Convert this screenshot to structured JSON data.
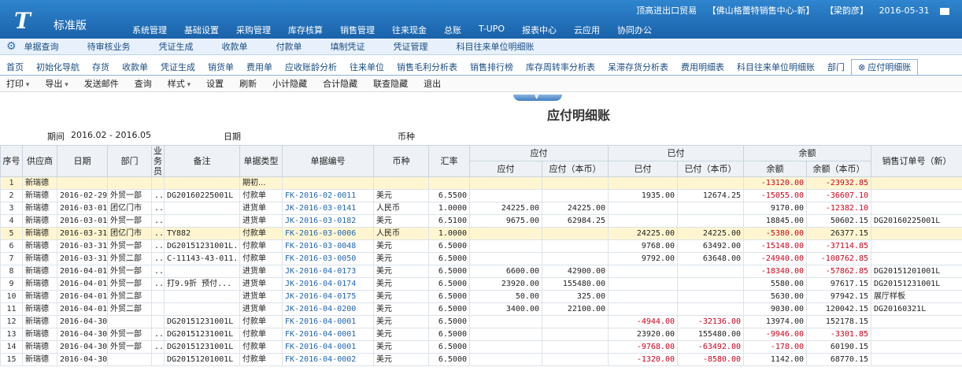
{
  "app": {
    "logo": "T",
    "logo_name": "标准版",
    "nav": [
      "系统管理",
      "基础设置",
      "采购管理",
      "库存核算",
      "销售管理",
      "往来现金",
      "总账",
      "T-UPO",
      "报表中心",
      "云应用",
      "协同办公"
    ],
    "company": "顶高进出口贸易",
    "org": "【佛山格蕾特销售中心-新】",
    "user": "【梁韵彦】",
    "date": "2016-05-31"
  },
  "subnav": [
    "单据查询",
    "待审核业务",
    "凭证生成",
    "收款单",
    "付款单",
    "填制凭证",
    "凭证管理",
    "科目往来单位明细账"
  ],
  "tabs": [
    "首页",
    "初始化导航",
    "存货",
    "收款单",
    "凭证生成",
    "销货单",
    "费用单",
    "应收账龄分析",
    "往来单位",
    "销售毛利分析表",
    "销售排行榜",
    "库存周转率分析表",
    "呆滞存货分析表",
    "费用明细表",
    "科目往来单位明细账",
    "部门",
    "应付明细账"
  ],
  "toolbar": [
    "打印",
    "导出",
    "发送邮件",
    "查询",
    "样式",
    "设置",
    "刷新",
    "小计隐藏",
    "合计隐藏",
    "联查隐藏",
    "退出"
  ],
  "report": {
    "title": "应付明细账",
    "period_label": "期间",
    "period_value": "2016.02 - 2016.05",
    "date_label": "日期",
    "currency_label": "币种"
  },
  "headers": {
    "idx": "序号",
    "supplier": "供应商",
    "date": "日期",
    "dept": "部门",
    "clerk": "业务员",
    "note": "备注",
    "btype": "单据类型",
    "bno": "单据编号",
    "cur": "币种",
    "rate": "汇率",
    "payable": "应付",
    "payable_amt": "应付",
    "payable_base": "应付（本币）",
    "paid": "已付",
    "paid_amt": "已付",
    "paid_base": "已付（本币）",
    "balance": "余额",
    "bal_amt": "余额",
    "bal_base": "余额（本币）",
    "order": "销售订单号（新）"
  },
  "rows": [
    {
      "idx": "1",
      "supplier": "新瑞德",
      "date": "",
      "dept": "",
      "clerk": "",
      "note": "",
      "btype": "期初...",
      "bno": "",
      "cur": "",
      "rate": "",
      "pay": "",
      "payb": "",
      "paid": "",
      "paidb": "",
      "bal": "-13120.00",
      "balb": "-23932.85",
      "order": "",
      "hl": true
    },
    {
      "idx": "2",
      "supplier": "新瑞德",
      "date": "2016-02-29",
      "dept": "外贸一部",
      "clerk": "...",
      "note": "DG20160225001L",
      "btype": "付款单",
      "bno": "FK-2016-02-0011",
      "cur": "美元",
      "rate": "6.5500",
      "pay": "",
      "payb": "",
      "paid": "1935.00",
      "paidb": "12674.25",
      "bal": "-15055.00",
      "balb": "-36607.10",
      "order": ""
    },
    {
      "idx": "3",
      "supplier": "新瑞德",
      "date": "2016-03-01",
      "dept": "团亿门市",
      "clerk": "...",
      "note": "",
      "btype": "进货单",
      "bno": "JK-2016-03-0141",
      "cur": "人民币",
      "rate": "1.0000",
      "pay": "24225.00",
      "payb": "24225.00",
      "paid": "",
      "paidb": "",
      "bal": "9170.00",
      "balb": "-12382.10",
      "order": ""
    },
    {
      "idx": "4",
      "supplier": "新瑞德",
      "date": "2016-03-01",
      "dept": "外贸一部",
      "clerk": "...",
      "note": "",
      "btype": "进货单",
      "bno": "JK-2016-03-0182",
      "cur": "美元",
      "rate": "6.5100",
      "pay": "9675.00",
      "payb": "62984.25",
      "paid": "",
      "paidb": "",
      "bal": "18845.00",
      "balb": "50602.15",
      "order": "DG20160225001L"
    },
    {
      "idx": "5",
      "supplier": "新瑞德",
      "date": "2016-03-31",
      "dept": "团亿门市",
      "clerk": "...",
      "note": "TY882",
      "btype": "付款单",
      "bno": "FK-2016-03-0006",
      "cur": "人民币",
      "rate": "1.0000",
      "pay": "",
      "payb": "",
      "paid": "24225.00",
      "paidb": "24225.00",
      "bal": "-5380.00",
      "balb": "26377.15",
      "order": "",
      "hl": true
    },
    {
      "idx": "6",
      "supplier": "新瑞德",
      "date": "2016-03-31",
      "dept": "外贸一部",
      "clerk": "...",
      "note": "DG20151231001L...",
      "btype": "付款单",
      "bno": "FK-2016-03-0048",
      "cur": "美元",
      "rate": "6.5000",
      "pay": "",
      "payb": "",
      "paid": "9768.00",
      "paidb": "63492.00",
      "bal": "-15148.00",
      "balb": "-37114.85",
      "order": ""
    },
    {
      "idx": "7",
      "supplier": "新瑞德",
      "date": "2016-03-31",
      "dept": "外贸二部",
      "clerk": "...",
      "note": "C-11143-43-011...",
      "btype": "付款单",
      "bno": "FK-2016-03-0050",
      "cur": "美元",
      "rate": "6.5000",
      "pay": "",
      "payb": "",
      "paid": "9792.00",
      "paidb": "63648.00",
      "bal": "-24940.00",
      "balb": "-100762.85",
      "order": ""
    },
    {
      "idx": "8",
      "supplier": "新瑞德",
      "date": "2016-04-01",
      "dept": "外贸一部",
      "clerk": "...",
      "note": "",
      "btype": "进货单",
      "bno": "JK-2016-04-0173",
      "cur": "美元",
      "rate": "6.5000",
      "pay": "6600.00",
      "payb": "42900.00",
      "paid": "",
      "paidb": "",
      "bal": "-18340.00",
      "balb": "-57862.85",
      "order": "DG20151201001L"
    },
    {
      "idx": "9",
      "supplier": "新瑞德",
      "date": "2016-04-01",
      "dept": "外贸一部",
      "clerk": "...",
      "note": "打9.9折  预付...",
      "btype": "进货单",
      "bno": "JK-2016-04-0174",
      "cur": "美元",
      "rate": "6.5000",
      "pay": "23920.00",
      "payb": "155480.00",
      "paid": "",
      "paidb": "",
      "bal": "5580.00",
      "balb": "97617.15",
      "order": "DG20151231001L"
    },
    {
      "idx": "10",
      "supplier": "新瑞德",
      "date": "2016-04-01",
      "dept": "外贸二部",
      "clerk": "",
      "note": "",
      "btype": "进货单",
      "bno": "JK-2016-04-0175",
      "cur": "美元",
      "rate": "6.5000",
      "pay": "50.00",
      "payb": "325.00",
      "paid": "",
      "paidb": "",
      "bal": "5630.00",
      "balb": "97942.15",
      "order": "展厅样板"
    },
    {
      "idx": "11",
      "supplier": "新瑞德",
      "date": "2016-04-01",
      "dept": "外贸二部",
      "clerk": "",
      "note": "",
      "btype": "进货单",
      "bno": "JK-2016-04-0200",
      "cur": "美元",
      "rate": "6.5000",
      "pay": "3400.00",
      "payb": "22100.00",
      "paid": "",
      "paidb": "",
      "bal": "9030.00",
      "balb": "120042.15",
      "order": "DG20160321L"
    },
    {
      "idx": "12",
      "supplier": "新瑞德",
      "date": "2016-04-30",
      "dept": "",
      "clerk": "",
      "note": "DG20151231001L",
      "btype": "付款单",
      "bno": "FK-2016-04-0001",
      "cur": "美元",
      "rate": "6.5000",
      "pay": "",
      "payb": "",
      "paid": "-4944.00",
      "paidb": "-32136.00",
      "bal": "13974.00",
      "balb": "152178.15",
      "order": ""
    },
    {
      "idx": "13",
      "supplier": "新瑞德",
      "date": "2016-04-30",
      "dept": "外贸一部",
      "clerk": "...",
      "note": "DG20151231001L",
      "btype": "付款单",
      "bno": "FK-2016-04-0001",
      "cur": "美元",
      "rate": "6.5000",
      "pay": "",
      "payb": "",
      "paid": "23920.00",
      "paidb": "155480.00",
      "bal": "-9946.00",
      "balb": "-3301.85",
      "order": ""
    },
    {
      "idx": "14",
      "supplier": "新瑞德",
      "date": "2016-04-30",
      "dept": "外贸一部",
      "clerk": "...",
      "note": "DG20151231001L",
      "btype": "付款单",
      "bno": "FK-2016-04-0001",
      "cur": "美元",
      "rate": "6.5000",
      "pay": "",
      "payb": "",
      "paid": "-9768.00",
      "paidb": "-63492.00",
      "bal": "-178.00",
      "balb": "60190.15",
      "order": ""
    },
    {
      "idx": "15",
      "supplier": "新瑞德",
      "date": "2016-04-30",
      "dept": "",
      "clerk": "",
      "note": "DG20151201001L",
      "btype": "付款单",
      "bno": "FK-2016-04-0002",
      "cur": "美元",
      "rate": "6.5000",
      "pay": "",
      "payb": "",
      "paid": "-1320.00",
      "paidb": "-8580.00",
      "bal": "1142.00",
      "balb": "68770.15",
      "order": ""
    }
  ]
}
